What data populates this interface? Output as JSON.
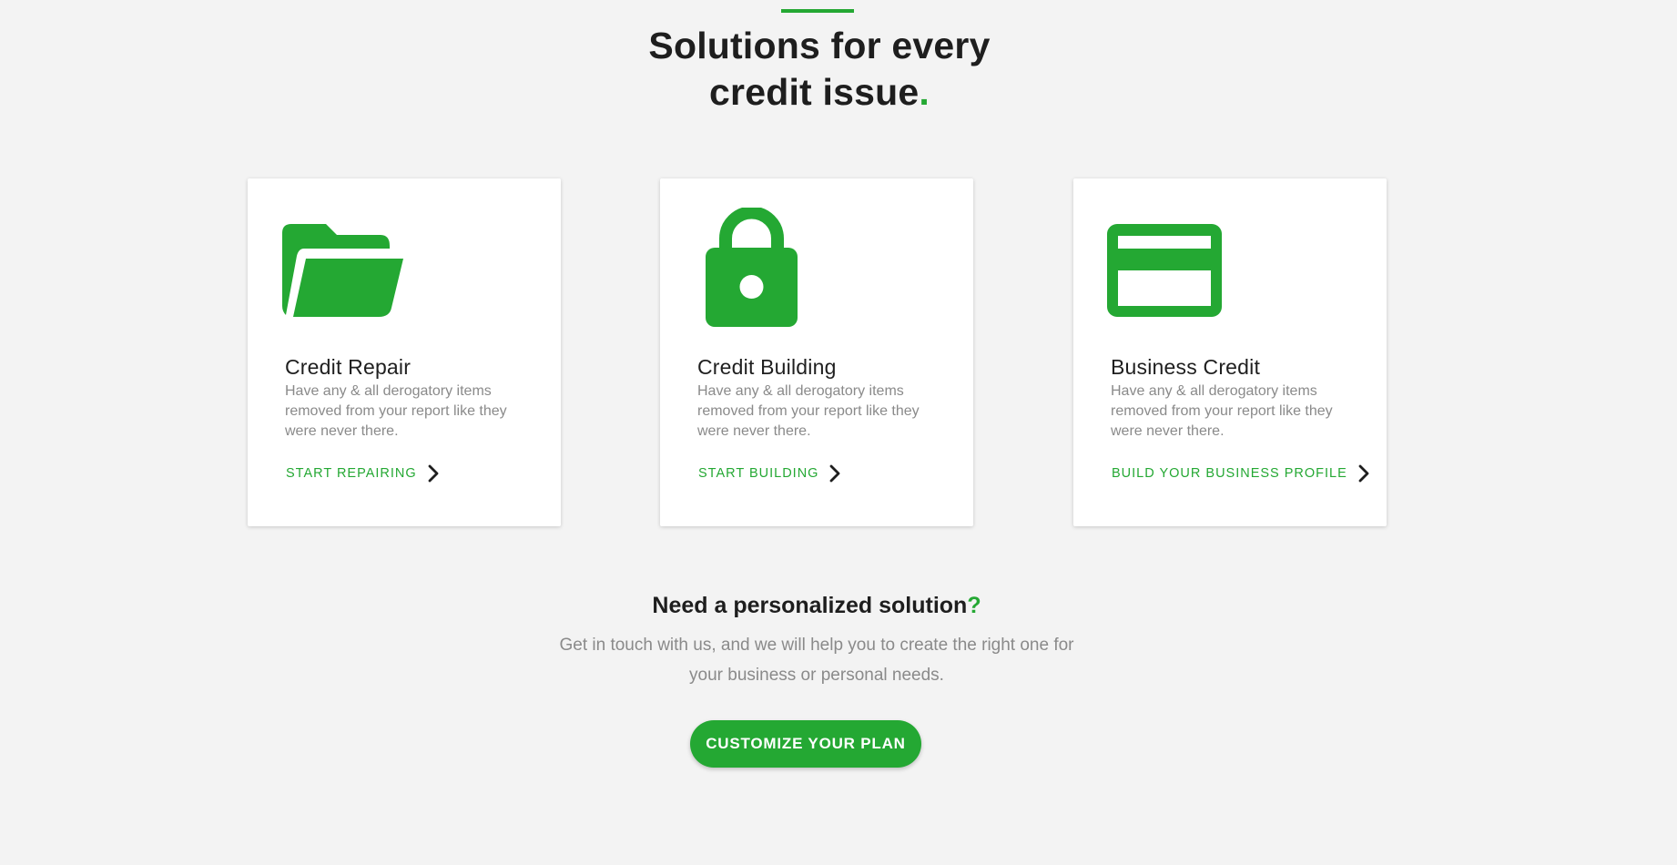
{
  "header": {
    "title_line1": "Solutions for every",
    "title_line2": "credit issue",
    "title_accent": "."
  },
  "cards": [
    {
      "icon": "folder-open-icon",
      "title": "Credit Repair",
      "description": "Have any & all derogatory items removed from your report like they were never there.",
      "link_label": "START REPAIRING"
    },
    {
      "icon": "lock-icon",
      "title": "Credit Building",
      "description": "Have any & all derogatory items removed from your report like they were never there.",
      "link_label": "START BUILDING"
    },
    {
      "icon": "credit-card-icon",
      "title": "Business Credit",
      "description": "Have any & all derogatory items removed from your report like they were never there.",
      "link_label": "BUILD YOUR BUSINESS PROFILE"
    }
  ],
  "personalized": {
    "title": "Need a personalized solution",
    "title_accent": "?",
    "description": "Get in touch with us, and we will help you to create the right one for your business or personal needs.",
    "button_label": "CUSTOMIZE YOUR PLAN"
  },
  "colors": {
    "brand_green": "#24a833",
    "background": "#f3f3f3",
    "heading": "#1e1e1e",
    "body_text": "#8a8a8a"
  }
}
